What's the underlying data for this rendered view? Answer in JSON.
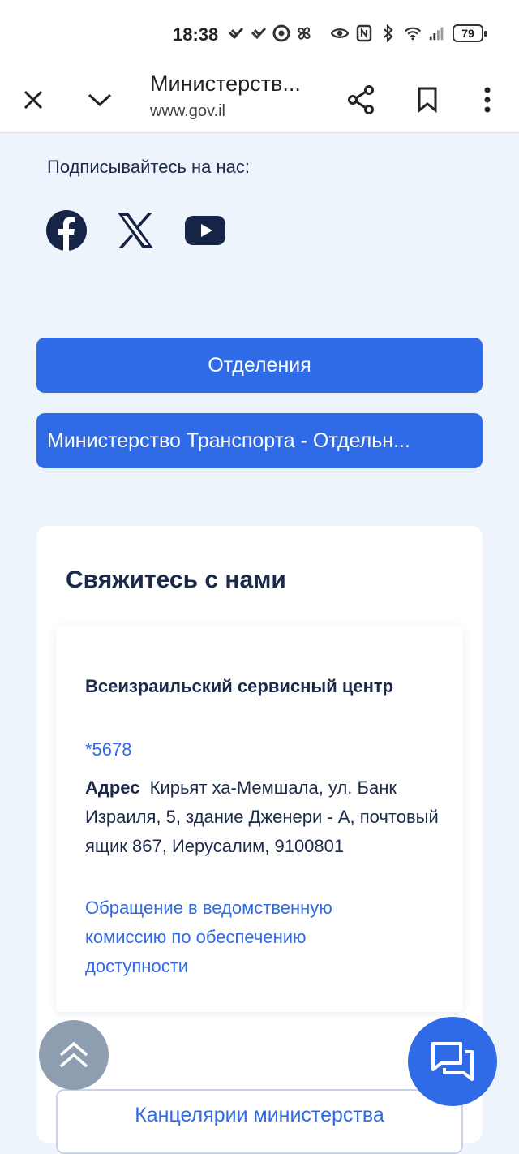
{
  "status_bar": {
    "time": "18:38",
    "battery": "79",
    "icons": [
      "signal-app-icon",
      "signal-app-icon",
      "chrome-icon",
      "fan-icon",
      "eye-icon",
      "nfc-icon",
      "bluetooth-icon",
      "wifi-icon",
      "cell-signal-icon"
    ]
  },
  "toolbar": {
    "title": "Министерств...",
    "url": "www.gov.il",
    "icons": [
      "close-icon",
      "chevron-down-icon",
      "share-icon",
      "bookmark-icon",
      "more-vert-icon"
    ]
  },
  "follow": {
    "label": "Подписывайтесь на нас:",
    "networks": [
      "facebook-icon",
      "x-icon",
      "youtube-icon"
    ]
  },
  "buttons": {
    "departments": "Отделения",
    "ministry": "Министерство Транспорта - Отдельн..."
  },
  "contact": {
    "title": "Свяжитесь с нами",
    "service_name": "Всеизраильский сервисный центр",
    "phone": "*5678",
    "address_label": "Адрес",
    "address_text": "Кирьят ха-Мемшала, ул. Банк Израиля, 5, здание Дженери - А, почтовый ящик 867, Иерусалим, 9100801",
    "accessibility_link": "Обращение в ведомственную комиссию по обеспечению доступности",
    "offices_button": "Канцелярии министерства"
  },
  "colors": {
    "accent": "#2f6be6",
    "page_bg": "#eef4fb",
    "text": "#1b2a4a",
    "fab_gray": "#8e9db0"
  }
}
